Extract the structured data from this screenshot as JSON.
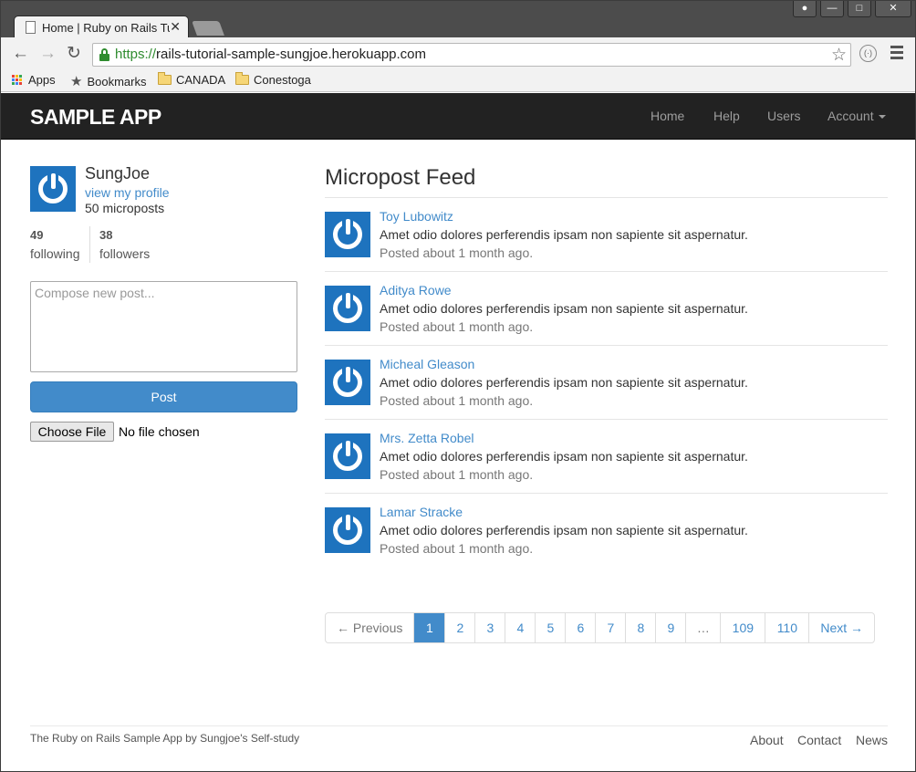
{
  "browser": {
    "tab_title": "Home | Ruby on Rails Tutorial Sample App",
    "url_protocol": "https://",
    "url_host": "rails-tutorial-sample-sungjoe.herokuapp.com",
    "bookmarks": [
      {
        "label": "Apps",
        "icon": "apps-grid-icon"
      },
      {
        "label": "Bookmarks",
        "icon": "star-icon"
      },
      {
        "label": "CANADA",
        "icon": "folder-icon"
      },
      {
        "label": "Conestoga",
        "icon": "folder-icon"
      }
    ],
    "window_buttons": [
      "user",
      "minimize",
      "maximize",
      "close"
    ]
  },
  "navbar": {
    "logo": "SAMPLE APP",
    "links": [
      "Home",
      "Help",
      "Users",
      "Account"
    ]
  },
  "sidebar": {
    "user_name": "SungJoe",
    "profile_link": "view my profile",
    "micropost_count": "50 microposts",
    "following_count": "49",
    "following_label": "following",
    "followers_count": "38",
    "followers_label": "followers",
    "compose_placeholder": "Compose new post...",
    "post_button": "Post",
    "file_button": "Choose File",
    "file_status": "No file chosen"
  },
  "feed": {
    "title": "Micropost Feed",
    "posts": [
      {
        "author": "Toy Lubowitz",
        "content": "Amet odio dolores perferendis ipsam non sapiente sit aspernatur.",
        "timestamp": "Posted about 1 month ago."
      },
      {
        "author": "Aditya Rowe",
        "content": "Amet odio dolores perferendis ipsam non sapiente sit aspernatur.",
        "timestamp": "Posted about 1 month ago."
      },
      {
        "author": "Micheal Gleason",
        "content": "Amet odio dolores perferendis ipsam non sapiente sit aspernatur.",
        "timestamp": "Posted about 1 month ago."
      },
      {
        "author": "Mrs. Zetta Robel",
        "content": "Amet odio dolores perferendis ipsam non sapiente sit aspernatur.",
        "timestamp": "Posted about 1 month ago."
      },
      {
        "author": "Lamar Stracke",
        "content": "Amet odio dolores perferendis ipsam non sapiente sit aspernatur.",
        "timestamp": "Posted about 1 month ago."
      }
    ]
  },
  "pagination": {
    "previous": "← Previous",
    "pages": [
      "1",
      "2",
      "3",
      "4",
      "5",
      "6",
      "7",
      "8",
      "9",
      "…",
      "109",
      "110"
    ],
    "current": "1",
    "next": "Next →"
  },
  "footer": {
    "text_prefix": "The",
    "app_link": "Ruby on Rails Sample App",
    "text_by": "by",
    "author_link": "Sungjoe's Self-study",
    "links": [
      "About",
      "Contact",
      "News"
    ]
  },
  "colors": {
    "navbar_bg": "#222222",
    "link": "#428bca",
    "gravatar": "#1e73be",
    "secure_url": "#2f8c2f"
  }
}
